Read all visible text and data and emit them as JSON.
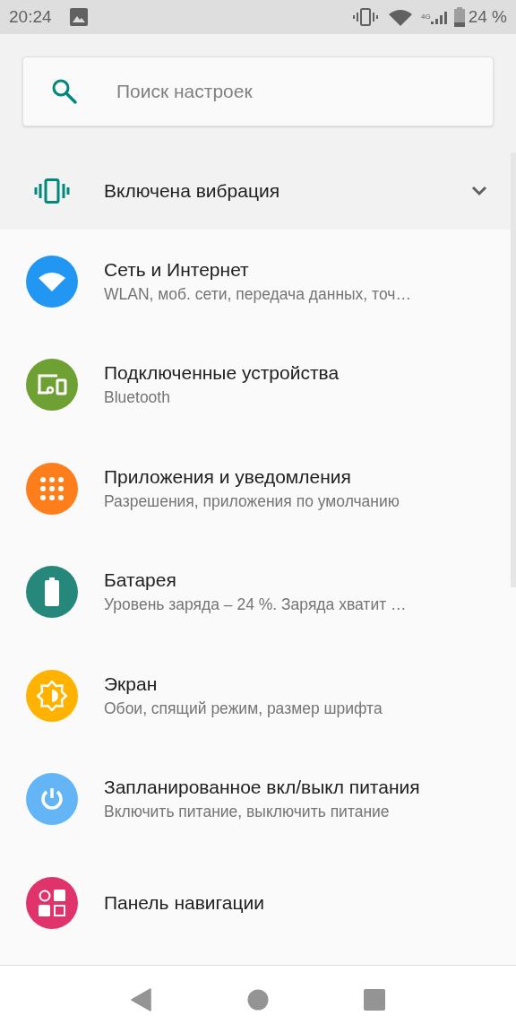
{
  "status_bar": {
    "time": "20:24",
    "network_type": "4G",
    "battery": "24 %"
  },
  "search": {
    "placeholder": "Поиск настроек"
  },
  "suggestion": {
    "title": "Включена вибрация",
    "expanded": false
  },
  "settings": [
    {
      "kind": "network",
      "color": "#2196f3",
      "title": "Сеть и Интернет",
      "subtitle": "WLAN, моб. сети, передача данных, точ…"
    },
    {
      "kind": "devices",
      "color": "#6fa033",
      "title": "Подключенные устройства",
      "subtitle": "Bluetooth"
    },
    {
      "kind": "apps",
      "color": "#ff7e1c",
      "title": "Приложения и уведомления",
      "subtitle": "Разрешения, приложения по умолчанию"
    },
    {
      "kind": "battery",
      "color": "#26877b",
      "title": "Батарея",
      "subtitle": "Уровень заряда – 24 %. Заряда хватит …"
    },
    {
      "kind": "display",
      "color": "#ffb300",
      "title": "Экран",
      "subtitle": "Обои, спящий режим, размер шрифта"
    },
    {
      "kind": "power",
      "color": "#64b5f6",
      "title": "Запланированное вкл/выкл питания",
      "subtitle": "Включить питание, выключить питание"
    },
    {
      "kind": "navbar",
      "color": "#e0336b",
      "title": "Панель навигации"
    }
  ]
}
